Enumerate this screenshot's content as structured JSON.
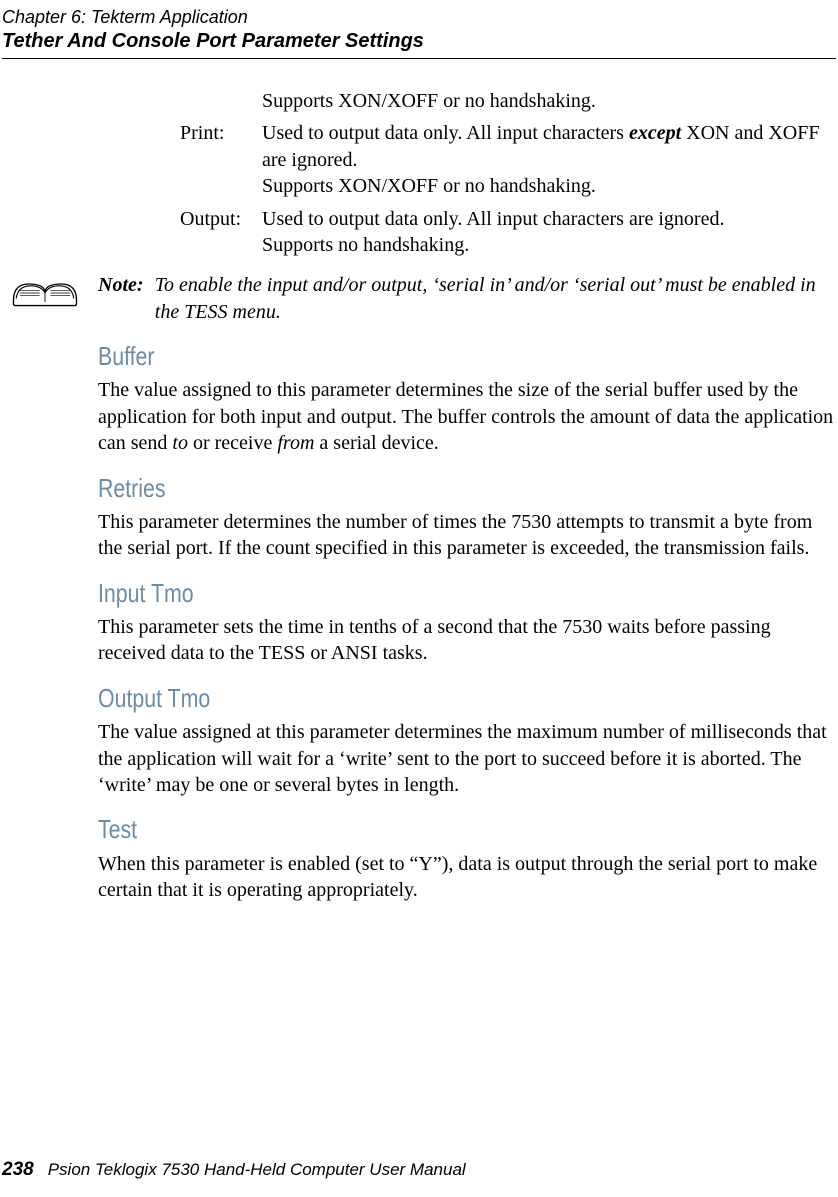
{
  "header": {
    "chapter": "Chapter  6:  Tekterm Application",
    "section": "Tether And Console Port Parameter Settings"
  },
  "defs": {
    "pre_line": "Supports XON/XOFF or no handshaking.",
    "print": {
      "label": "Print:",
      "line1a": "Used to output data only. All input characters ",
      "line1b": " XON and XOFF are ignored.",
      "except": "except",
      "line2": "Supports XON/XOFF or no handshaking."
    },
    "output": {
      "label": "Output:",
      "line1": "Used to output data only. All input characters are ignored.",
      "line2": "Supports no handshaking."
    }
  },
  "note": {
    "label": "Note:",
    "text": "To enable the input and/or output, ‘serial in’ and/or ‘serial out’ must be enabled in the TESS menu."
  },
  "sections": {
    "buffer": {
      "head": "Buffer",
      "body_a": "The value assigned to this parameter determines the size of the serial buffer used by the application for both input and output. The buffer controls the amount of data the application can send ",
      "to": "to",
      "body_b": " or receive ",
      "from": "from",
      "body_c": " a serial device."
    },
    "retries": {
      "head": "Retries",
      "body": "This parameter determines the number of times the 7530 attempts to transmit a byte from the serial port. If the count specified in this parameter is exceeded, the transmission fails."
    },
    "input_tmo": {
      "head": "Input Tmo",
      "body": "This parameter sets the time in tenths of a second that the 7530 waits before passing received data to the TESS or ANSI tasks."
    },
    "output_tmo": {
      "head": "Output Tmo",
      "body": "The value assigned at this parameter determines the maximum number of milliseconds that the application will wait for a ‘write’ sent to the port to succeed before it is aborted. The ‘write’ may be one or several bytes in length."
    },
    "test": {
      "head": "Test",
      "body": "When this parameter is enabled (set to “Y”), data is output through the serial port to make certain that it is operating appropriately."
    }
  },
  "footer": {
    "pagenum": "238",
    "title": "Psion Teklogix 7530 Hand-Held Computer User Manual"
  }
}
